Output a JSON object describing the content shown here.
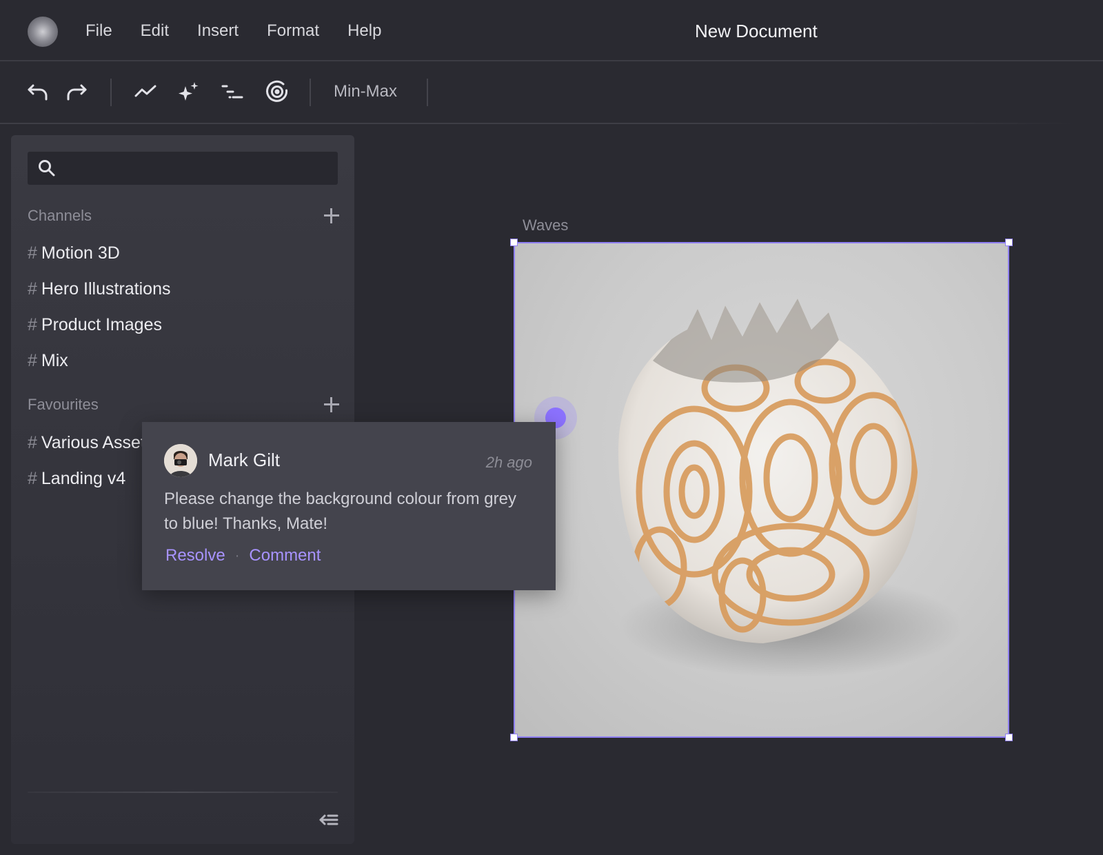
{
  "app": {
    "document_title": "New Document"
  },
  "menu": [
    "File",
    "Edit",
    "Insert",
    "Format",
    "Help"
  ],
  "toolbar": {
    "tools": [
      "undo-icon",
      "redo-icon",
      "line-chart-icon",
      "sparkle-icon",
      "list-indent-icon",
      "target-icon"
    ],
    "mode_label": "Min-Max"
  },
  "sidebar": {
    "search_placeholder": "",
    "channels_title": "Channels",
    "channels": [
      "Motion 3D",
      "Hero Illustrations",
      "Product Images",
      "Mix"
    ],
    "favourites_title": "Favourites",
    "favourites": [
      "Various Assets",
      "Landing v4"
    ],
    "hash": "#"
  },
  "canvas": {
    "frame_label": "Waves",
    "accent_color": "#8f7ff3",
    "marker_color": "#8c72ff"
  },
  "comment": {
    "author": "Mark Gilt",
    "time": "2h ago",
    "text": "Please change the background colour from grey to blue! Thanks, Mate!",
    "resolve_label": "Resolve",
    "separator": "·",
    "comment_label": "Comment",
    "action_color": "#a893ff"
  }
}
